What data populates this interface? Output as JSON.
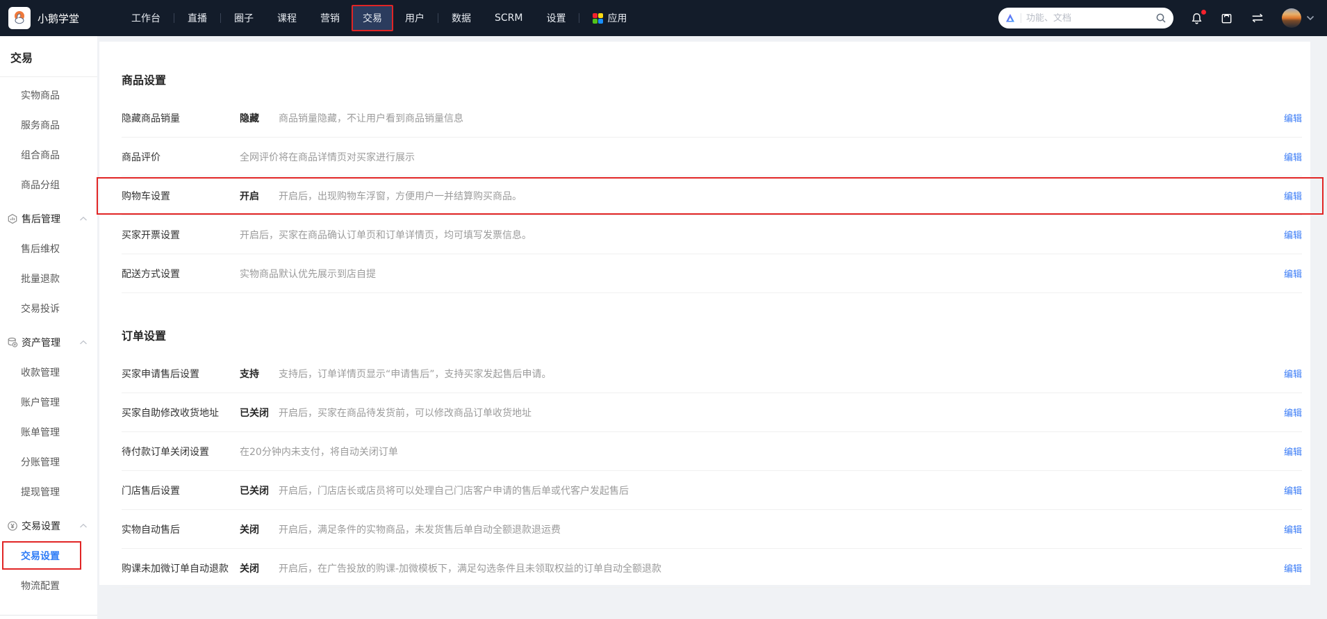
{
  "topbar": {
    "brand": "小鹅学堂",
    "nav": [
      {
        "name": "workbench",
        "label": "工作台",
        "sep_after": true
      },
      {
        "name": "live",
        "label": "直播",
        "sep_after": true
      },
      {
        "name": "community",
        "label": "圈子"
      },
      {
        "name": "course",
        "label": "课程"
      },
      {
        "name": "marketing",
        "label": "营销"
      },
      {
        "name": "trade",
        "label": "交易",
        "active": true,
        "highlighted": true
      },
      {
        "name": "users",
        "label": "用户",
        "sep_after": true
      },
      {
        "name": "data",
        "label": "数据"
      },
      {
        "name": "scrm",
        "label": "SCRM"
      },
      {
        "name": "settings",
        "label": "设置",
        "sep_after": true
      },
      {
        "name": "apps",
        "label": "应用",
        "icon": "apps-grid-icon"
      }
    ],
    "search": {
      "placeholder": "功能、文档"
    },
    "has_notification_badge": true
  },
  "sidebar": {
    "title": "交易",
    "items": [
      {
        "type": "link",
        "name": "physical-goods",
        "label": "实物商品"
      },
      {
        "type": "link",
        "name": "service-goods",
        "label": "服务商品"
      },
      {
        "type": "link",
        "name": "combo-goods",
        "label": "组合商品"
      },
      {
        "type": "link",
        "name": "goods-groups",
        "label": "商品分组"
      },
      {
        "type": "group",
        "name": "aftersale-management",
        "label": "售后管理",
        "icon": "aftersale-badge-icon",
        "expanded": true
      },
      {
        "type": "link",
        "name": "aftersale-rights",
        "label": "售后维权"
      },
      {
        "type": "link",
        "name": "batch-refund",
        "label": "批量退款"
      },
      {
        "type": "link",
        "name": "trade-complaint",
        "label": "交易投诉"
      },
      {
        "type": "group",
        "name": "asset-management",
        "label": "资产管理",
        "icon": "assets-database-icon",
        "expanded": true
      },
      {
        "type": "link",
        "name": "payment-collection",
        "label": "收款管理"
      },
      {
        "type": "link",
        "name": "account-management",
        "label": "账户管理"
      },
      {
        "type": "link",
        "name": "bill-management",
        "label": "账单管理"
      },
      {
        "type": "link",
        "name": "split-account",
        "label": "分账管理"
      },
      {
        "type": "link",
        "name": "withdrawal-management",
        "label": "提现管理"
      },
      {
        "type": "group",
        "name": "trade-settings-group",
        "label": "交易设置",
        "icon": "coin-settings-icon",
        "expanded": true
      },
      {
        "type": "link",
        "name": "trade-settings",
        "label": "交易设置",
        "active": true,
        "highlighted": true
      },
      {
        "type": "link",
        "name": "logistics-config",
        "label": "物流配置"
      }
    ]
  },
  "main": {
    "edit_label": "编辑",
    "sections": [
      {
        "title": "商品设置",
        "name": "goods-settings",
        "rows": [
          {
            "name": "hide-goods-sales",
            "label": "隐藏商品销量",
            "value": "隐藏",
            "desc": "商品销量隐藏，不让用户看到商品销量信息"
          },
          {
            "name": "goods-review",
            "label": "商品评价",
            "value": "",
            "desc": "全网评价将在商品详情页对买家进行展示"
          },
          {
            "name": "cart-settings",
            "label": "购物车设置",
            "value": "开启",
            "desc": "开启后，出现购物车浮窗，方便用户一并结算购买商品。",
            "highlighted": true
          },
          {
            "name": "buyer-invoice",
            "label": "买家开票设置",
            "value": "",
            "desc": "开启后，买家在商品确认订单页和订单详情页，均可填写发票信息。"
          },
          {
            "name": "delivery-method",
            "label": "配送方式设置",
            "value": "",
            "desc": "实物商品默认优先展示到店自提"
          }
        ]
      },
      {
        "title": "订单设置",
        "name": "order-settings",
        "rows": [
          {
            "name": "buyer-aftersale-apply",
            "label": "买家申请售后设置",
            "value": "支持",
            "desc": "支持后，订单详情页显示“申请售后”，支持买家发起售后申请。"
          },
          {
            "name": "buyer-edit-address",
            "label": "买家自助修改收货地址",
            "value": "已关闭",
            "desc": "开启后，买家在商品待发货前，可以修改商品订单收货地址"
          },
          {
            "name": "unpaid-order-close",
            "label": "待付款订单关闭设置",
            "value": "",
            "desc": "在20分钟内未支付，将自动关闭订单"
          },
          {
            "name": "store-aftersale",
            "label": "门店售后设置",
            "value": "已关闭",
            "desc": "开启后，门店店长或店员将可以处理自己门店客户申请的售后单或代客户发起售后"
          },
          {
            "name": "physical-auto-aftersale",
            "label": "实物自动售后",
            "value": "关闭",
            "desc": "开启后，满足条件的实物商品，未发货售后单自动全额退款退运费"
          },
          {
            "name": "course-no-wechat-auto-refund",
            "label": "购课未加微订单自动退款",
            "value": "关闭",
            "desc": "开启后，在广告投放的购课-加微模板下，满足勾选条件且未领取权益的订单自动全额退款"
          }
        ]
      }
    ]
  },
  "colors": {
    "topbar_bg": "#131c2a",
    "active_tab_bg": "#2b3c5e",
    "highlight_red": "#e12525",
    "link_blue": "#3b7cf6",
    "active_item_blue": "#2e7cf6",
    "apps_dot_colors": [
      "#f5222d",
      "#fadb14",
      "#52c41a",
      "#1890ff"
    ]
  }
}
